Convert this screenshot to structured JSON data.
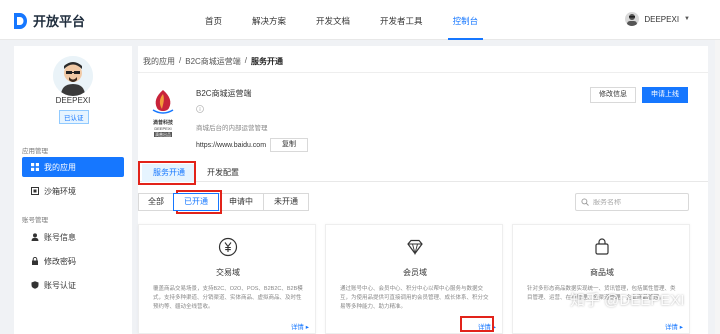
{
  "header": {
    "brand": "开放平台",
    "nav": [
      "首页",
      "解决方案",
      "开发文档",
      "开发者工具",
      "控制台"
    ],
    "active_nav": "控制台",
    "user_name": "DEEPEXI"
  },
  "sidebar": {
    "profile_name": "DEEPEXI",
    "verified_badge": "已认证",
    "group_app": "应用管理",
    "group_account": "账号管理",
    "items": [
      {
        "label": "我的应用",
        "icon": "grid-icon",
        "active": true
      },
      {
        "label": "沙箱环境",
        "icon": "box-icon",
        "active": false
      },
      {
        "label": "账号信息",
        "icon": "user-icon",
        "active": false
      },
      {
        "label": "修改密码",
        "icon": "lock-icon",
        "active": false
      },
      {
        "label": "账号认证",
        "icon": "shield-icon",
        "active": false
      }
    ]
  },
  "breadcrumb": {
    "items": [
      "我的应用",
      "/",
      "B2C商城运营端",
      "/",
      "服务开通"
    ]
  },
  "app": {
    "logo_name": "滴普科技",
    "logo_sub": "DEEPEXI",
    "logo_tag": "滴普出品",
    "name": "B2C商城运营端",
    "description": "商城后台的内部运营管理",
    "url": "https://www.baidu.com",
    "copy_label": "复制",
    "edit_label": "修改信息",
    "launch_label": "申请上线"
  },
  "tabs": [
    "服务开通",
    "开发配置"
  ],
  "active_tab": "服务开通",
  "filters": [
    "全部",
    "已开通",
    "申请中",
    "未开通"
  ],
  "active_filter": "已开通",
  "search": {
    "placeholder": "服务名称"
  },
  "cards": [
    {
      "title": "交易域",
      "icon": "yuan-coin-icon",
      "description": "覆盖商品交易场景，支持B2C、O2O、POS、B2B2C、B2B模式，支持多种渠道、分销渠道、实体商品、虚拟商品、及时性预约等、疆动全线营收。",
      "more": "详情 ▸"
    },
    {
      "title": "会员域",
      "icon": "diamond-icon",
      "description": "通过账号中心、会员中心、积分中心以帮中心服务与数据交互，为使用品提供可直接调用的会员管理、成长体系、积分交易等多种能力、助力精准。",
      "more": "详情 ▸"
    },
    {
      "title": "商品域",
      "icon": "bag-icon",
      "description": "针对多形态商品数据实现统一、货讯管理，包括属性管理、类目管理、运营、在线管理、全渠道管理、企业商品管理。",
      "more": "详情 ▸"
    }
  ],
  "watermark": "知乎 @DEEPEXI",
  "colors": {
    "accent": "#1677ff",
    "highlight": "#e2231a"
  }
}
